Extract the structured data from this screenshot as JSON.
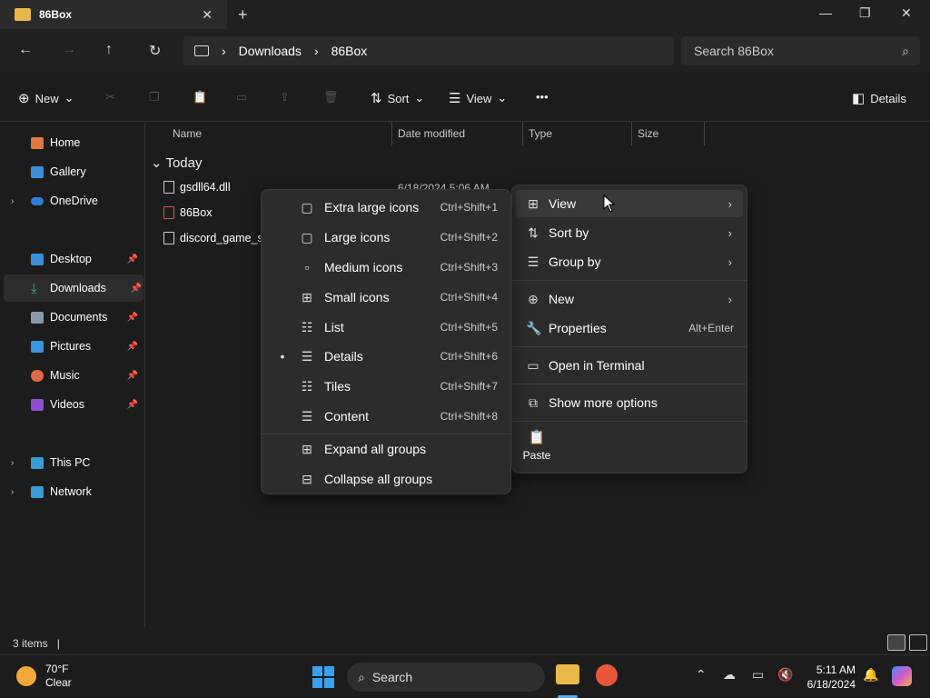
{
  "window": {
    "tab_title": "86Box",
    "close_tab": "✕",
    "new_tab": "+",
    "minimize": "—",
    "maximize": "❐",
    "close": "✕"
  },
  "nav": {
    "back": "←",
    "forward": "→",
    "up": "↑",
    "refresh": "↻",
    "breadcrumb": [
      "Downloads",
      "86Box"
    ],
    "breadcrumb_sep": "›",
    "search_placeholder": "Search 86Box"
  },
  "toolbar": {
    "new_label": "New",
    "sort_label": "Sort",
    "view_label": "View",
    "more_label": "•••",
    "details_label": "Details",
    "chevron": "⌄"
  },
  "sidebar": {
    "home": "Home",
    "gallery": "Gallery",
    "onedrive": "OneDrive",
    "desktop": "Desktop",
    "downloads": "Downloads",
    "documents": "Documents",
    "pictures": "Pictures",
    "music": "Music",
    "videos": "Videos",
    "thispc": "This PC",
    "network": "Network",
    "chev": "›",
    "pin": "📌"
  },
  "columns": {
    "name": "Name",
    "date": "Date modified",
    "type": "Type",
    "size": "Size"
  },
  "group_label": "Today",
  "files": [
    {
      "name": "gsdll64.dll",
      "date": "6/18/2024 5:06 AM"
    },
    {
      "name": "86Box"
    },
    {
      "name": "discord_game_sc"
    }
  ],
  "status": {
    "items": "3 items",
    "cursor": "|"
  },
  "context_menu": {
    "view": "View",
    "sort_by": "Sort by",
    "group_by": "Group by",
    "new": "New",
    "properties": "Properties",
    "properties_sc": "Alt+Enter",
    "terminal": "Open in Terminal",
    "more_options": "Show more options",
    "paste": "Paste",
    "arrow": "›"
  },
  "view_submenu": {
    "xl": "Extra large icons",
    "xl_sc": "Ctrl+Shift+1",
    "large": "Large icons",
    "large_sc": "Ctrl+Shift+2",
    "medium": "Medium icons",
    "medium_sc": "Ctrl+Shift+3",
    "small": "Small icons",
    "small_sc": "Ctrl+Shift+4",
    "list": "List",
    "list_sc": "Ctrl+Shift+5",
    "details": "Details",
    "details_sc": "Ctrl+Shift+6",
    "tiles": "Tiles",
    "tiles_sc": "Ctrl+Shift+7",
    "content": "Content",
    "content_sc": "Ctrl+Shift+8",
    "expand": "Expand all groups",
    "collapse": "Collapse all groups",
    "bullet": "•"
  },
  "taskbar": {
    "temp": "70°F",
    "condition": "Clear",
    "search": "Search",
    "time": "5:11 AM",
    "date": "6/18/2024"
  }
}
